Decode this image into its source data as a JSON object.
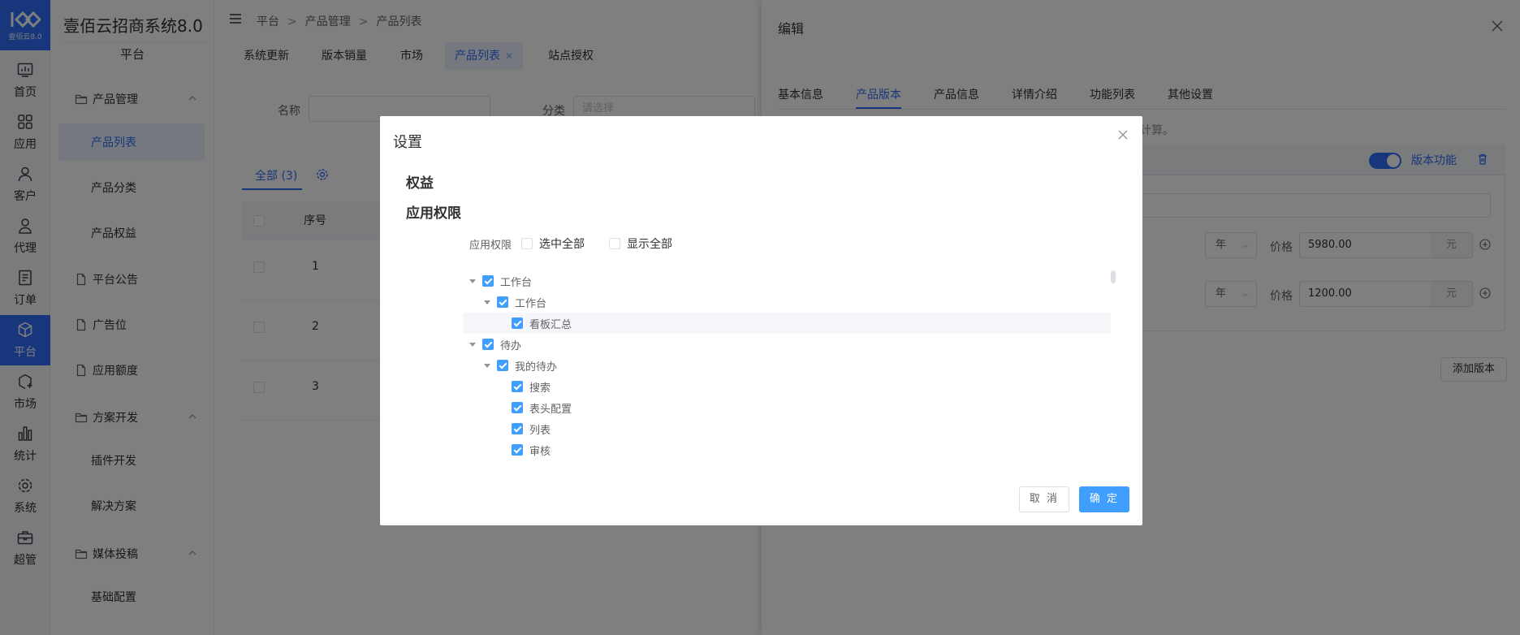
{
  "brand": {
    "logo_sub": "壹佰云8.0",
    "app_title": "壹佰云招商系统8.0",
    "section": "平台"
  },
  "rail": [
    {
      "label": "首页",
      "icon": "dashboard-icon"
    },
    {
      "label": "应用",
      "icon": "apps-grid-icon"
    },
    {
      "label": "客户",
      "icon": "user-icon"
    },
    {
      "label": "代理",
      "icon": "agent-icon"
    },
    {
      "label": "订单",
      "icon": "order-icon"
    },
    {
      "label": "平台",
      "icon": "cube-icon",
      "active": true
    },
    {
      "label": "市场",
      "icon": "market-icon"
    },
    {
      "label": "统计",
      "icon": "chart-icon"
    },
    {
      "label": "系统",
      "icon": "gear-icon"
    },
    {
      "label": "超管",
      "icon": "briefcase-icon"
    }
  ],
  "sidebar": {
    "groups": [
      {
        "label": "产品管理"
      },
      {
        "label": "平台公告"
      },
      {
        "label": "广告位"
      },
      {
        "label": "应用额度"
      },
      {
        "label": "方案开发"
      },
      {
        "label": "媒体投稿"
      }
    ],
    "items": [
      {
        "label": "产品列表",
        "active": true
      },
      {
        "label": "产品分类"
      },
      {
        "label": "产品权益"
      },
      {
        "label": "插件开发"
      },
      {
        "label": "解决方案"
      },
      {
        "label": "基础配置"
      }
    ]
  },
  "breadcrumb": [
    "平台",
    "产品管理",
    "产品列表"
  ],
  "tabs": [
    "系统更新",
    "版本销量",
    "市场",
    "产品列表",
    "站点授权"
  ],
  "search": {
    "name_label": "名称",
    "category_label": "分类",
    "category_placeholder": "请选择"
  },
  "list": {
    "all_tab": "全部",
    "all_count": "(3)",
    "col_index": "序号",
    "rows": [
      "1",
      "2",
      "3"
    ]
  },
  "drawer": {
    "title": "编辑",
    "tabs": [
      "基本信息",
      "产品版本",
      "产品信息",
      "详情介绍",
      "功能列表",
      "其他设置"
    ],
    "active_tab": "产品版本",
    "calc_hint": "计算。",
    "version_function": "版本功能",
    "toggle_on": true,
    "prices": [
      {
        "unit": "年",
        "price_label": "价格",
        "price": "5980.00",
        "currency": "元"
      },
      {
        "unit": "年",
        "price_label": "价格",
        "price": "1200.00",
        "currency": "元"
      }
    ],
    "add_version": "添加版本"
  },
  "dialog": {
    "title": "设置",
    "section_rights": "权益",
    "section_perm": "应用权限",
    "perm_label": "应用权限",
    "select_all": "选中全部",
    "show_all": "显示全部",
    "tree": [
      {
        "label": "工作台",
        "level": 0,
        "caret": true,
        "checked": true
      },
      {
        "label": "工作台",
        "level": 1,
        "caret": true,
        "checked": true
      },
      {
        "label": "看板汇总",
        "level": 2,
        "caret": false,
        "checked": true,
        "highlight": true
      },
      {
        "label": "待办",
        "level": 0,
        "caret": true,
        "checked": true
      },
      {
        "label": "我的待办",
        "level": 1,
        "caret": true,
        "checked": true
      },
      {
        "label": "搜索",
        "level": 2,
        "caret": false,
        "checked": true
      },
      {
        "label": "表头配置",
        "level": 2,
        "caret": false,
        "checked": true
      },
      {
        "label": "列表",
        "level": 2,
        "caret": false,
        "checked": true
      },
      {
        "label": "审核",
        "level": 2,
        "caret": false,
        "checked": true
      }
    ],
    "cancel": "取 消",
    "confirm": "确 定"
  },
  "colors": {
    "primary": "#409eff",
    "brand": "#2f6cf6",
    "overlay": "rgba(0,0,0,0.5)"
  }
}
